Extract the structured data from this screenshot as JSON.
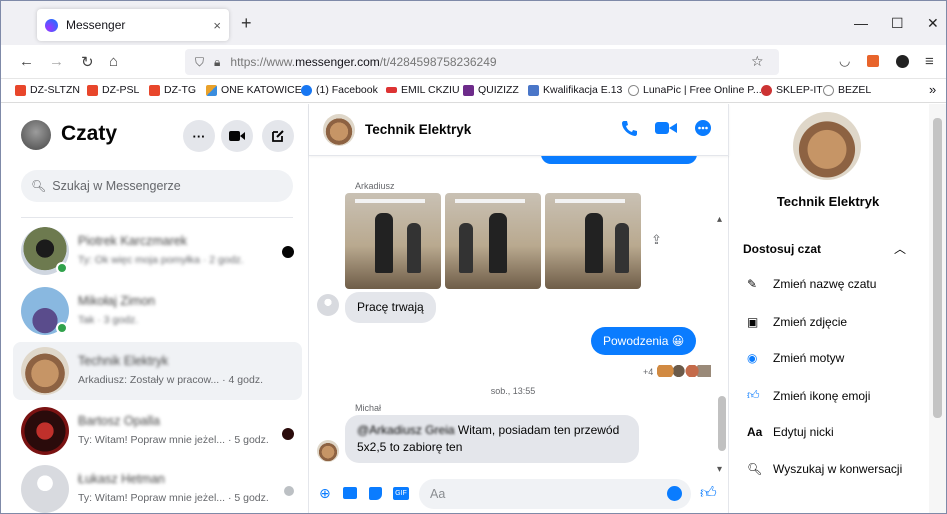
{
  "browser": {
    "tab_title": "Messenger",
    "tab_close": "×",
    "new_tab": "+",
    "win_min": "—",
    "win_max": "☐",
    "win_close": "✕",
    "url_prefix": "https://www.",
    "url_domain": "messenger.com",
    "url_path": "/t/4284598758236249",
    "bookmarks": [
      {
        "label": "DZ-SLTZN",
        "color": "#e8462b"
      },
      {
        "label": "DZ-PSL",
        "color": "#e8462b"
      },
      {
        "label": "DZ-TG",
        "color": "#e8462b"
      },
      {
        "label": "ONE KATOWICE",
        "color": "#e9a12a"
      },
      {
        "label": "(1) Facebook",
        "color": "#1877f2"
      },
      {
        "label": "EMIL CKZIU",
        "color": "#d33"
      },
      {
        "label": "QUIZIZZ",
        "color": "#6d2b8a"
      },
      {
        "label": "Kwalifikacja E.13",
        "color": "#4a76c8"
      },
      {
        "label": "LunaPic | Free Online P...",
        "color": "#888"
      },
      {
        "label": "SKLEP-IT",
        "color": "#c33"
      },
      {
        "label": "BEZEL",
        "color": "#888"
      }
    ],
    "bookmarks_more": "»"
  },
  "sidebar": {
    "title": "Czaty",
    "search_placeholder": "Szukaj w Messengerze",
    "chats": [
      {
        "name": "Piotrek Karczmarek",
        "preview": "Ty: Ok więc moja pomyłka · 2 godz.",
        "online": true,
        "unread": false
      },
      {
        "name": "Mikołaj Zimon",
        "preview": "Tak · 3 godz.",
        "online": true,
        "unread": false
      },
      {
        "name": "Technik Elektryk",
        "preview": "Arkadiusz: Zostały w pracow... · 4 godz.",
        "online": false,
        "unread": false
      },
      {
        "name": "Bartosz Opalla",
        "preview": "Ty: Witam! Popraw mnie jeżel... · 5 godz.",
        "online": false,
        "unread": true
      },
      {
        "name": "Łukasz Hetman",
        "preview": "Ty: Witam! Popraw mnie jeżel... · 5 godz.",
        "online": false,
        "unread": false
      }
    ]
  },
  "conversation": {
    "name": "Technik Elektryk",
    "sender_1": "Arkadiusz",
    "msg_in_1": "Pracę trwają",
    "msg_out_1": "Powodzenia 😀",
    "reactions": "+4",
    "timestamp": "sob., 13:55",
    "sender_2": "Michał",
    "msg_in_2_mention": "@Arkadiusz Greia",
    "msg_in_2": " Witam, posiadam ten przewód 5x2,5 to zabiorę ten",
    "composer_placeholder": "Aa"
  },
  "details": {
    "name": "Technik Elektryk",
    "section": "Dostosuj czat",
    "items": [
      {
        "icon": "pencil-icon",
        "label": "Zmień nazwę czatu"
      },
      {
        "icon": "image-icon",
        "label": "Zmień zdjęcie"
      },
      {
        "icon": "theme-icon",
        "label": "Zmień motyw"
      },
      {
        "icon": "thumbs-up-icon",
        "label": "Zmień ikonę emoji"
      },
      {
        "icon": "nickname-icon",
        "label": "Edytuj nicki"
      },
      {
        "icon": "search-icon",
        "label": "Wyszukaj w konwersacji"
      }
    ]
  },
  "colors": {
    "accent": "#0a7cff",
    "online": "#31a24c"
  }
}
